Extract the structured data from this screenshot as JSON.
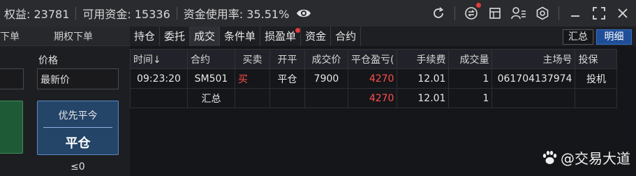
{
  "topbar": {
    "equity": "权益: 23781",
    "available": "可用资金: 15336",
    "usage": "资金使用率: 35.51%",
    "icons": [
      "eye-icon",
      "refresh-icon",
      "exchange-icon",
      "calculator-icon",
      "user-settings-icon",
      "gear-icon",
      "minimize-icon",
      "fullscreen-icon",
      "close-icon"
    ]
  },
  "left": {
    "tab1": "下单",
    "tab2": "期权下单",
    "price_label": "价格",
    "price_value": "最新价",
    "btn_top": "优先平今",
    "btn_bottom": "平仓",
    "limit": "≤0"
  },
  "tabs": [
    "持仓",
    "委托",
    "成交",
    "条件单",
    "损盈单",
    "资金",
    "合约"
  ],
  "active_tab": "成交",
  "buttons": {
    "summary": "汇总",
    "detail": "明细"
  },
  "table": {
    "headers": [
      "时间↓",
      "合约",
      "买卖",
      "开平",
      "成交价",
      "平仓盈亏(",
      "手续费",
      "成交量",
      "主场号",
      "投保"
    ],
    "row": [
      "09:23:20",
      "SM501",
      "买",
      "平仓",
      "7900",
      "4270",
      "12.01",
      "1",
      "061704137974",
      "投机"
    ],
    "summary": [
      "",
      "汇总",
      "",
      "",
      "",
      "4270",
      "12.01",
      "1",
      "",
      ""
    ]
  },
  "watermark": "@交易大道",
  "colors": {
    "profit": "#ff4d4d",
    "accent": "#1f4e97",
    "buy": "#ff4d4d"
  }
}
